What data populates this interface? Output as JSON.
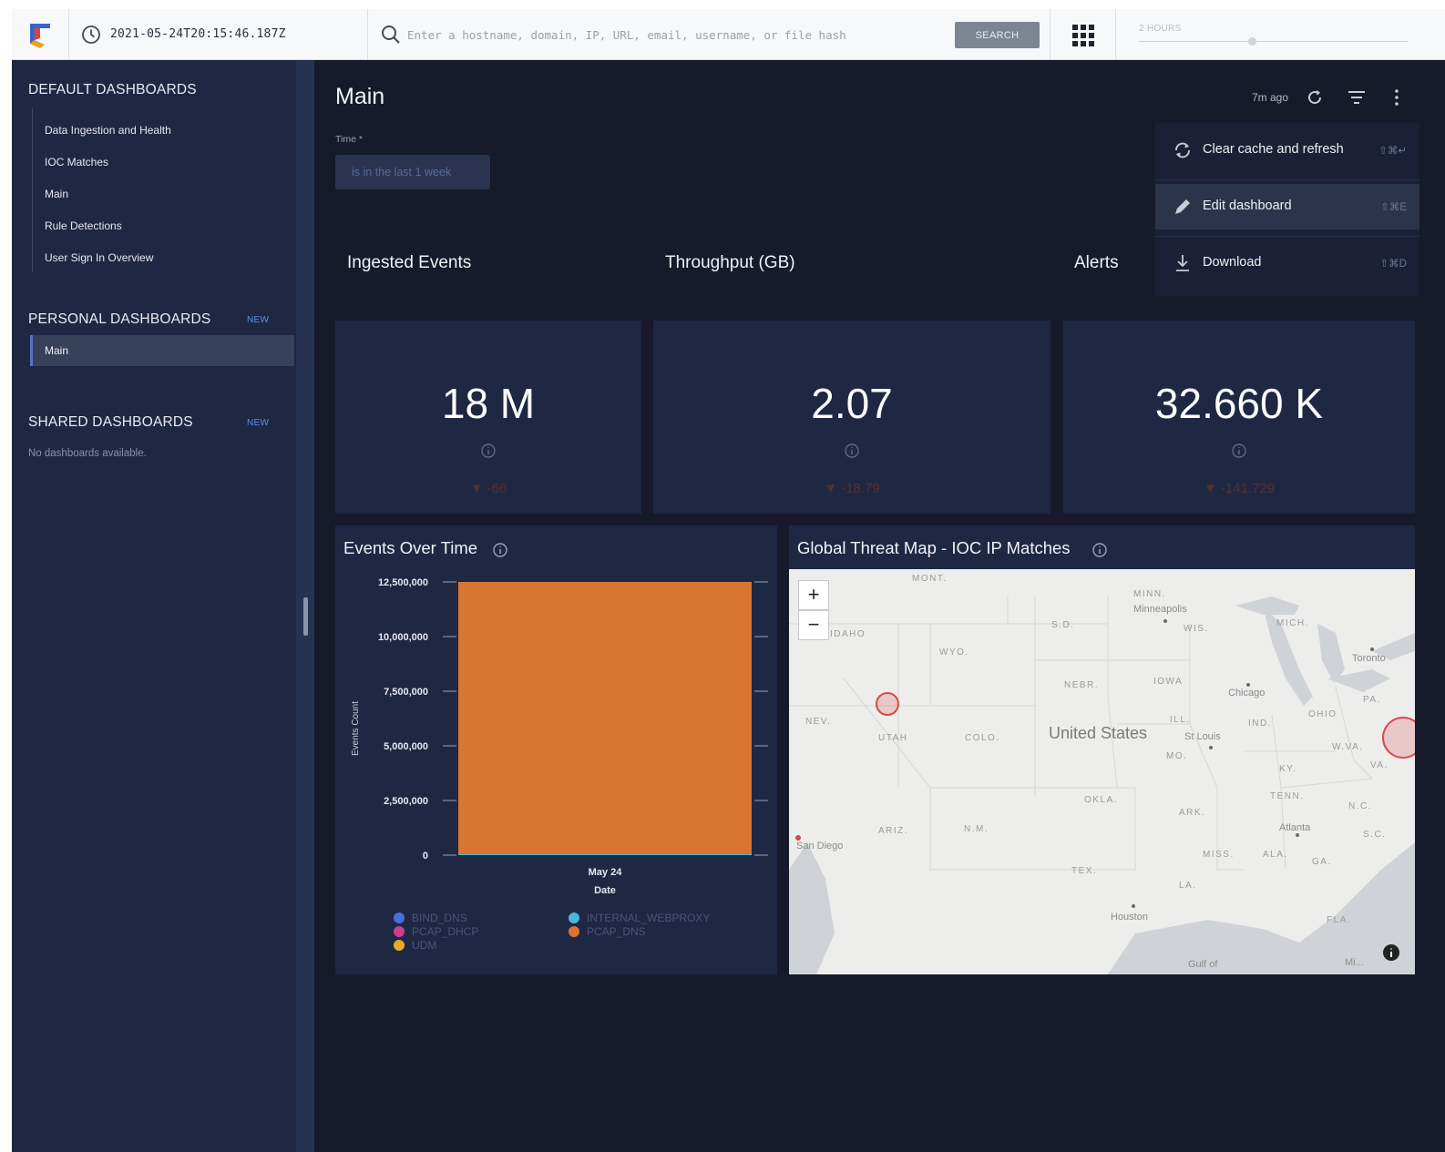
{
  "topbar": {
    "timestamp": "2021-05-24T20:15:46.187Z",
    "search_placeholder": "Enter a hostname, domain, IP, URL, email, username, or file hash",
    "search_button": "SEARCH",
    "range_label": "2 HOURS"
  },
  "sidebar": {
    "default_heading": "DEFAULT DASHBOARDS",
    "default_items": [
      "Data Ingestion and Health",
      "IOC Matches",
      "Main",
      "Rule Detections",
      "User Sign In Overview"
    ],
    "personal_heading": "PERSONAL DASHBOARDS",
    "personal_new": "NEW",
    "personal_items": [
      "Main"
    ],
    "shared_heading": "SHARED DASHBOARDS",
    "shared_new": "NEW",
    "shared_empty": "No dashboards available."
  },
  "main": {
    "title": "Main",
    "time_label": "Time *",
    "time_filter": "is in the last 1 week",
    "updated": "7m ago"
  },
  "menu": {
    "clear_cache": "Clear cache and refresh",
    "clear_cache_shortcut": "⇧⌘↵",
    "edit": "Edit dashboard",
    "edit_shortcut": "⇧⌘E",
    "download": "Download",
    "download_shortcut": "⇧⌘D"
  },
  "stats": [
    {
      "title": "Ingested Events",
      "value": "18 M",
      "delta": "▼ -66"
    },
    {
      "title": "Throughput (GB)",
      "value": "2.07",
      "delta": "▼ -18.79"
    },
    {
      "title": "Alerts",
      "value": "32.660 K",
      "delta": "▼ -141.729"
    }
  ],
  "events_panel": {
    "title": "Events Over Time"
  },
  "chart_data": {
    "type": "bar",
    "stacked": true,
    "categories": [
      "May 24"
    ],
    "series": [
      {
        "name": "BIND_DNS",
        "values": [
          0
        ],
        "color": "#4a6fd8"
      },
      {
        "name": "INTERNAL_WEBPROXY",
        "values": [
          60000
        ],
        "color": "#4bb8d8"
      },
      {
        "name": "PCAP_DHCP",
        "values": [
          0
        ],
        "color": "#c9408e"
      },
      {
        "name": "PCAP_DNS",
        "values": [
          12440000
        ],
        "color": "#d97431"
      },
      {
        "name": "UDM",
        "values": [
          0
        ],
        "color": "#e5ab2c"
      }
    ],
    "xlabel": "Date",
    "ylabel": "Events Count",
    "ylim": [
      0,
      12500000
    ],
    "yticks": [
      0,
      2500000,
      5000000,
      7500000,
      10000000,
      12500000
    ],
    "ytick_labels": [
      "0",
      "2,500,000",
      "5,000,000",
      "7,500,000",
      "10,000,000",
      "12,500,000"
    ],
    "grid": false,
    "legend": "bottom"
  },
  "map_panel": {
    "title": "Global Threat Map - IOC IP Matches",
    "country_label": "United States",
    "state_labels": [
      "MONT.",
      "IDAHO",
      "WYO.",
      "S.D.",
      "MINN.",
      "WIS.",
      "MICH.",
      "IOWA",
      "NEBR.",
      "NEV.",
      "UTAH",
      "COLO.",
      "ILL.",
      "IND.",
      "OHIO",
      "PA.",
      "MO.",
      "KY.",
      "W.VA.",
      "VA.",
      "OKLA.",
      "ARK.",
      "TENN.",
      "N.C.",
      "S.C.",
      "ARIZ.",
      "N.M.",
      "MISS.",
      "ALA.",
      "GA.",
      "TEX.",
      "LA.",
      "FLA."
    ],
    "city_labels": [
      "Minneapolis",
      "Toronto",
      "Chicago",
      "St Louis",
      "Atlanta",
      "Houston",
      "San Diego",
      "Gulf of",
      "Mi..."
    ],
    "zoom_in": "+",
    "zoom_out": "−"
  },
  "icons": {
    "logo": "chronicle-logo-icon",
    "clock": "clock-icon",
    "search": "search-icon",
    "apps": "apps-grid-icon",
    "refresh": "refresh-icon",
    "filter": "filter-icon",
    "more": "more-vertical-icon",
    "info": "info-icon",
    "clear_cache": "sync-icon",
    "edit": "pencil-icon",
    "download": "download-icon"
  },
  "colors": {
    "app_bg": "#161a2a",
    "panel_bg": "#1e2843",
    "accent": "#5b72c7",
    "delta_down": "#8a3a3a"
  }
}
